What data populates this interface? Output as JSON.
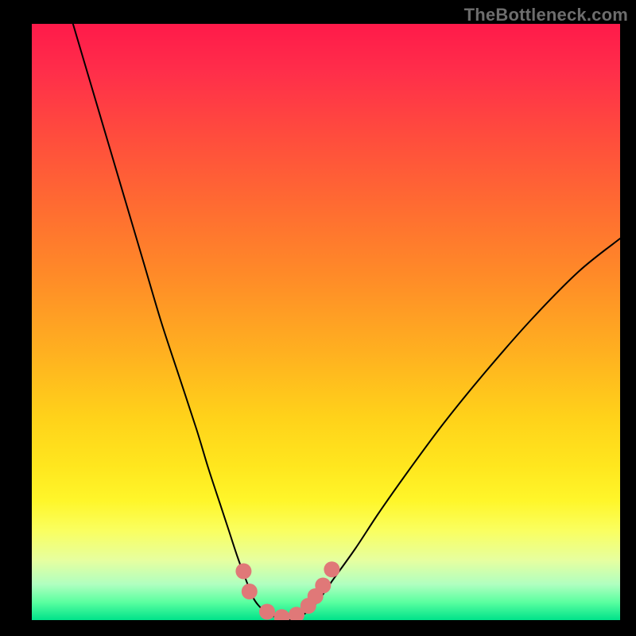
{
  "watermark": "TheBottleneck.com",
  "chart_data": {
    "type": "line",
    "title": "",
    "xlabel": "",
    "ylabel": "",
    "xlim": [
      0,
      100
    ],
    "ylim": [
      0,
      100
    ],
    "grid": false,
    "legend": false,
    "series": [
      {
        "name": "bottleneck-curve",
        "color": "#000000",
        "x": [
          7,
          10,
          13,
          16,
          19,
          22,
          25,
          28,
          30,
          32,
          33.5,
          35,
          36.5,
          37.5,
          38.5,
          40,
          42,
          44,
          46,
          48.5,
          51,
          55,
          59,
          64,
          70,
          77,
          85,
          93,
          100
        ],
        "y": [
          100,
          90,
          80,
          70,
          60,
          50,
          41,
          32,
          25.5,
          19.5,
          15,
          10.5,
          6.5,
          4,
          2.5,
          1.2,
          0.3,
          0,
          0.8,
          3,
          6.5,
          12,
          18,
          25,
          33,
          41.5,
          50.5,
          58.5,
          64
        ]
      }
    ],
    "markers": [
      {
        "name": "marker-left-upper",
        "x": 36.0,
        "y": 8.2
      },
      {
        "name": "marker-left-lower",
        "x": 37,
        "y": 4.8
      },
      {
        "name": "marker-bottom-1",
        "x": 40.0,
        "y": 1.4
      },
      {
        "name": "marker-bottom-2",
        "x": 42.5,
        "y": 0.5
      },
      {
        "name": "marker-bottom-3",
        "x": 45.0,
        "y": 0.9
      },
      {
        "name": "marker-right-1",
        "x": 47.0,
        "y": 2.4
      },
      {
        "name": "marker-right-2",
        "x": 48.2,
        "y": 4.0
      },
      {
        "name": "marker-right-3",
        "x": 49.5,
        "y": 5.8
      },
      {
        "name": "marker-right-4",
        "x": 51,
        "y": 8.5
      }
    ],
    "marker_style": {
      "color": "#e07878",
      "radius_px": 10
    },
    "gradient_stops": [
      {
        "pos": 0.0,
        "color": "#ff1a4a"
      },
      {
        "pos": 0.3,
        "color": "#ff6a32"
      },
      {
        "pos": 0.66,
        "color": "#ffd21a"
      },
      {
        "pos": 0.85,
        "color": "#faff60"
      },
      {
        "pos": 1.0,
        "color": "#00e28a"
      }
    ]
  }
}
